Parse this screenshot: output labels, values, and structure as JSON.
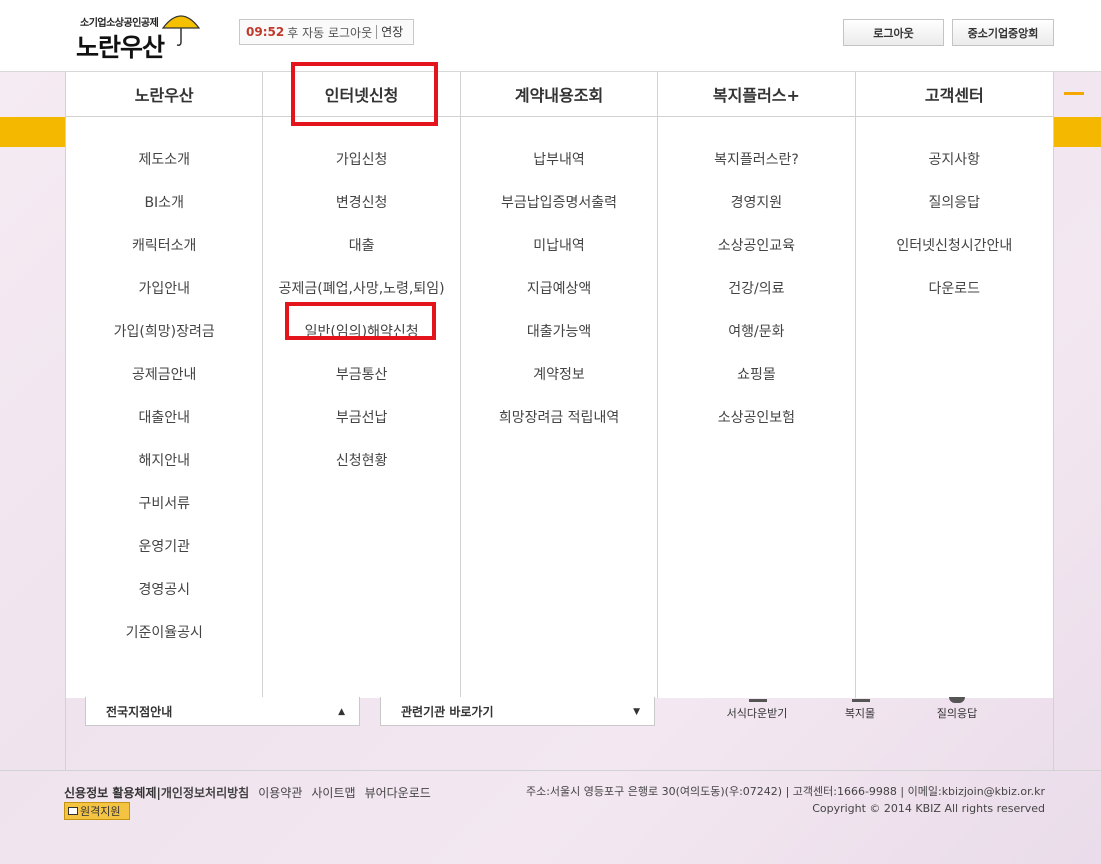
{
  "header": {
    "logo_sub": "소기업소상공인공제",
    "logo_main": "노란우산",
    "session": {
      "time": "09:52",
      "text": "후 자동 로그아웃",
      "extend": "연장"
    },
    "logout": "로그아웃",
    "kbiz": "중소기업중앙회"
  },
  "menu": [
    {
      "title": "노란우산",
      "items": [
        "제도소개",
        "BI소개",
        "캐릭터소개",
        "가입안내",
        "가입(희망)장려금",
        "공제금안내",
        "대출안내",
        "해지안내",
        "구비서류",
        "운영기관",
        "경영공시",
        "기준이율공시"
      ]
    },
    {
      "title": "인터넷신청",
      "items": [
        "가입신청",
        "변경신청",
        "대출",
        "공제금(폐업,사망,노령,퇴임)",
        "일반(임의)해약신청",
        "부금통산",
        "부금선납",
        "신청현황"
      ]
    },
    {
      "title": "계약내용조회",
      "items": [
        "납부내역",
        "부금납입증명서출력",
        "미납내역",
        "지급예상액",
        "대출가능액",
        "계약정보",
        "희망장려금 적립내역"
      ]
    },
    {
      "title": "복지플러스+",
      "items": [
        "복지플러스란?",
        "경영지원",
        "소상공인교육",
        "건강/의료",
        "여행/문화",
        "쇼핑몰",
        "소상공인보험"
      ]
    },
    {
      "title": "고객센터",
      "items": [
        "공지사항",
        "질의응답",
        "인터넷신청시간안내",
        "다운로드"
      ]
    }
  ],
  "lower": {
    "select1": "전국지점안내",
    "select2": "관련기관 바로가기",
    "quick1": "서식다운받기",
    "quick2": "복지몰",
    "quick3": "질의응답"
  },
  "footer": {
    "link1": "신용정보 활용체제",
    "link2": "개인정보처리방침",
    "link3": "이용약관",
    "link4": "사이트맵",
    "link5": "뷰어다운로드",
    "remote": "원격지원",
    "address": "주소:서울시 영등포구 은행로 30(여의도동)(우:07242) | 고객센터:1666-9988 | 이메일:kbizjoin@kbiz.or.kr",
    "copyright": "Copyright © 2014 KBIZ All rights reserved"
  },
  "colors": {
    "accent": "#f5b800",
    "highlight": "#e3141c"
  }
}
